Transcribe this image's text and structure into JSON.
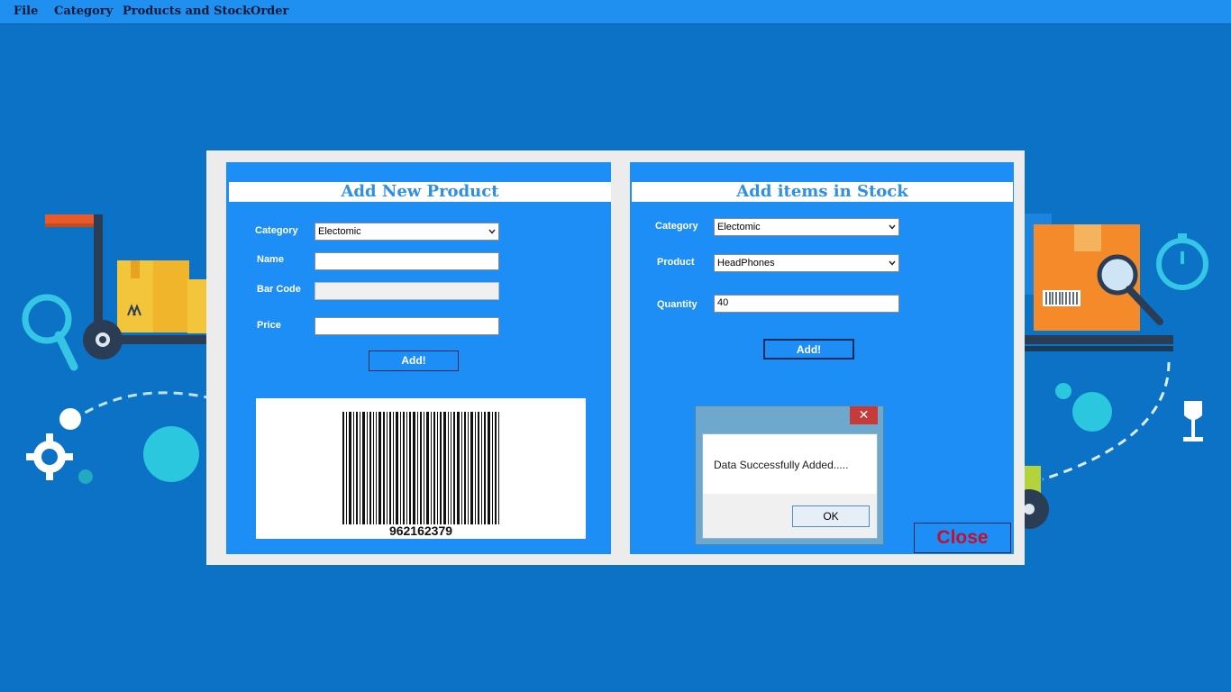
{
  "menu": {
    "file": "File",
    "category": "Category",
    "products_and_stock": "Products and Stock",
    "order": "Order"
  },
  "colors": {
    "menubar": "#1f8ff0",
    "background": "#0b72c5",
    "panel": "#1e8ef7",
    "title_text": "#2d8fe8",
    "close_text": "#c4102b"
  },
  "add_product": {
    "title": "Add New Product",
    "category_label": "Category",
    "category_value": "Electomic",
    "name_label": "Name",
    "name_value": "",
    "barcode_label": "Bar Code",
    "barcode_value": "",
    "price_label": "Price",
    "price_value": "",
    "add_button": "Add!",
    "barcode_number": "962162379"
  },
  "add_stock": {
    "title": "Add items in Stock",
    "category_label": "Category",
    "category_value": "Electomic",
    "product_label": "Product",
    "product_value": "HeadPhones",
    "quantity_label": "Quantity",
    "quantity_value": "40",
    "add_button": "Add!"
  },
  "dialog": {
    "close_glyph": "✕",
    "message": "Data Successfully Added.....",
    "ok_button": "OK"
  },
  "close_button": "Close"
}
